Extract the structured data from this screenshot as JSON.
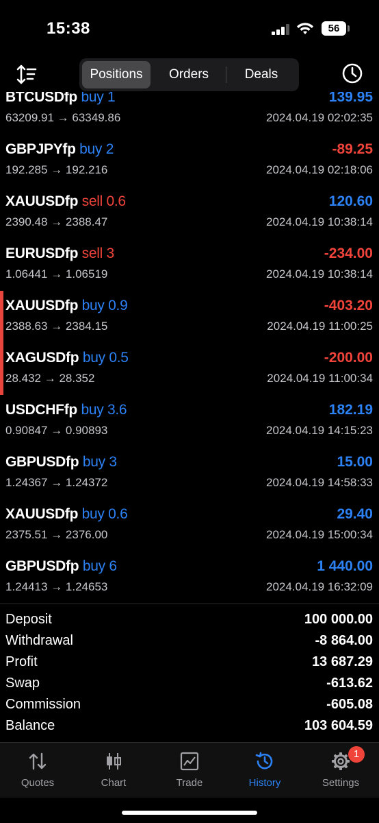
{
  "status_bar": {
    "time": "15:38",
    "battery": "56"
  },
  "toolbar": {
    "tabs": [
      {
        "label": "Positions",
        "active": true
      },
      {
        "label": "Orders",
        "active": false
      },
      {
        "label": "Deals",
        "active": false
      }
    ],
    "left_icon": "sort-icon",
    "right_icon": "clock-icon"
  },
  "positions": [
    {
      "symbol": "BTCUSDfp",
      "direction": "buy",
      "volume": "1",
      "profit": "139.95",
      "open_price": "63209.91",
      "close_price": "63349.86",
      "time": "2024.04.19 02:02:35"
    },
    {
      "symbol": "GBPJPYfp",
      "direction": "buy",
      "volume": "2",
      "profit": "-89.25",
      "open_price": "192.285",
      "close_price": "192.216",
      "time": "2024.04.19 02:18:06"
    },
    {
      "symbol": "XAUUSDfp",
      "direction": "sell",
      "volume": "0.6",
      "profit": "120.60",
      "open_price": "2390.48",
      "close_price": "2388.47",
      "time": "2024.04.19 10:38:14"
    },
    {
      "symbol": "EURUSDfp",
      "direction": "sell",
      "volume": "3",
      "profit": "-234.00",
      "open_price": "1.06441",
      "close_price": "1.06519",
      "time": "2024.04.19 10:38:14"
    },
    {
      "symbol": "XAUUSDfp",
      "direction": "buy",
      "volume": "0.9",
      "profit": "-403.20",
      "open_price": "2388.63",
      "close_price": "2384.15",
      "time": "2024.04.19 11:00:25",
      "marked": true
    },
    {
      "symbol": "XAGUSDfp",
      "direction": "buy",
      "volume": "0.5",
      "profit": "-200.00",
      "open_price": "28.432",
      "close_price": "28.352",
      "time": "2024.04.19 11:00:34",
      "marked": true
    },
    {
      "symbol": "USDCHFfp",
      "direction": "buy",
      "volume": "3.6",
      "profit": "182.19",
      "open_price": "0.90847",
      "close_price": "0.90893",
      "time": "2024.04.19 14:15:23"
    },
    {
      "symbol": "GBPUSDfp",
      "direction": "buy",
      "volume": "3",
      "profit": "15.00",
      "open_price": "1.24367",
      "close_price": "1.24372",
      "time": "2024.04.19 14:58:33"
    },
    {
      "symbol": "XAUUSDfp",
      "direction": "buy",
      "volume": "0.6",
      "profit": "29.40",
      "open_price": "2375.51",
      "close_price": "2376.00",
      "time": "2024.04.19 15:00:34"
    },
    {
      "symbol": "GBPUSDfp",
      "direction": "buy",
      "volume": "6",
      "profit": "1 440.00",
      "open_price": "1.24413",
      "close_price": "1.24653",
      "time": "2024.04.19 16:32:09"
    }
  ],
  "price_arrow": "→",
  "summary": [
    {
      "label": "Deposit",
      "value": "100 000.00"
    },
    {
      "label": "Withdrawal",
      "value": "-8 864.00"
    },
    {
      "label": "Profit",
      "value": "13 687.29"
    },
    {
      "label": "Swap",
      "value": "-613.62"
    },
    {
      "label": "Commission",
      "value": "-605.08"
    },
    {
      "label": "Balance",
      "value": "103 604.59"
    }
  ],
  "tabbar": [
    {
      "label": "Quotes",
      "icon": "quotes-icon",
      "active": false
    },
    {
      "label": "Chart",
      "icon": "candlestick-icon",
      "active": false
    },
    {
      "label": "Trade",
      "icon": "trade-chart-icon",
      "active": false
    },
    {
      "label": "History",
      "icon": "history-icon",
      "active": true
    },
    {
      "label": "Settings",
      "icon": "gear-icon",
      "active": false,
      "badge": "1"
    }
  ],
  "colors": {
    "accent": "#2c82f5",
    "negative": "#f0443a",
    "marker": "#e8453c"
  }
}
